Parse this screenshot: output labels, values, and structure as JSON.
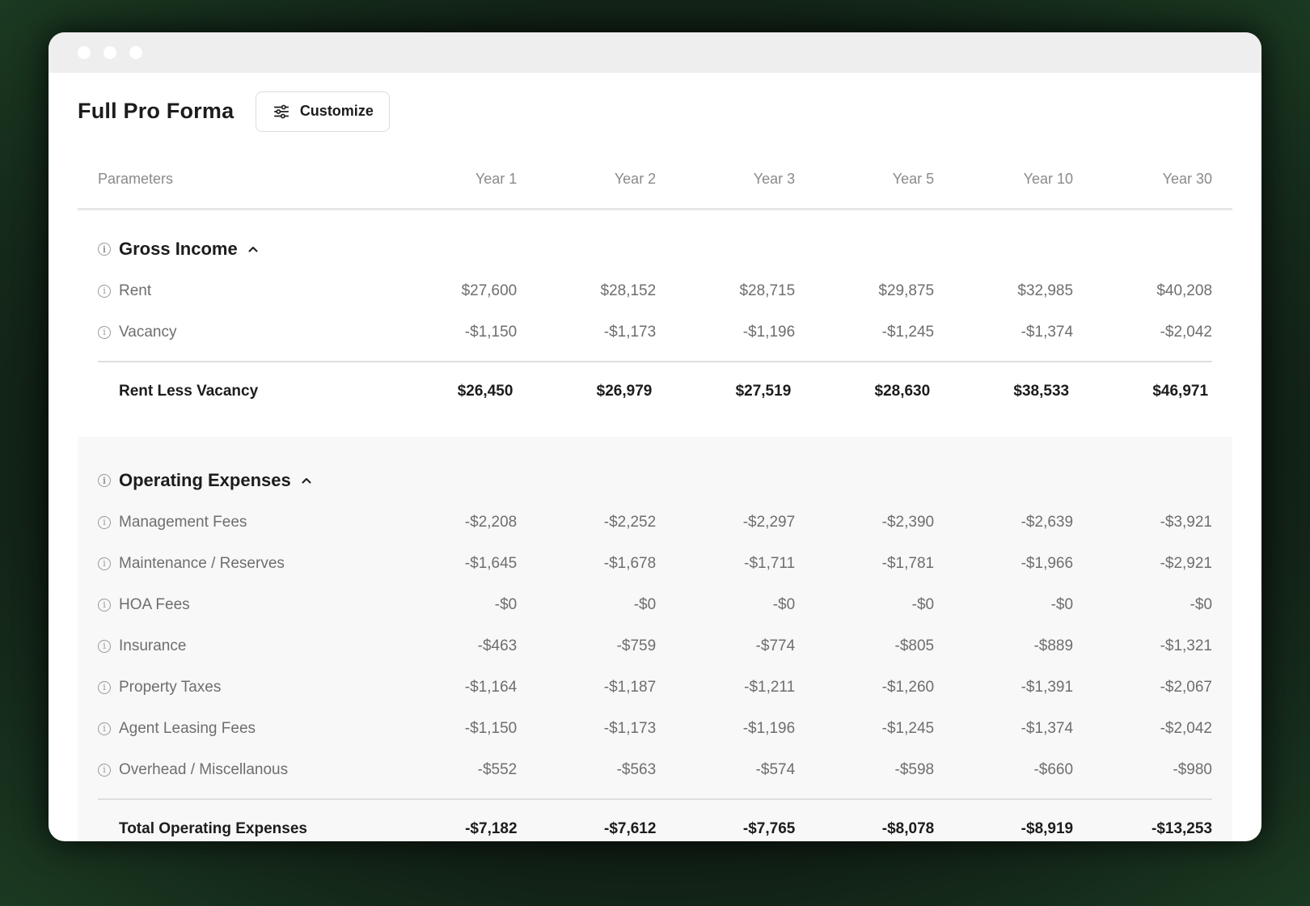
{
  "page": {
    "title": "Full Pro Forma",
    "customize_label": "Customize"
  },
  "columns": {
    "parameters": "Parameters",
    "years": [
      "Year 1",
      "Year 2",
      "Year 3",
      "Year 5",
      "Year 10",
      "Year 30"
    ]
  },
  "gross_income": {
    "title": "Gross Income",
    "rows": [
      {
        "label": "Rent",
        "values": [
          "$27,600",
          "$28,152",
          "$28,715",
          "$29,875",
          "$32,985",
          "$40,208"
        ]
      },
      {
        "label": "Vacancy",
        "values": [
          "-$1,150",
          "-$1,173",
          "-$1,196",
          "-$1,245",
          "-$1,374",
          "-$2,042"
        ]
      }
    ],
    "total": {
      "label": "Rent Less Vacancy",
      "values": [
        "$26,450",
        "$26,979",
        "$27,519",
        "$28,630",
        "$38,533",
        "$46,971"
      ]
    }
  },
  "operating_expenses": {
    "title": "Operating Expenses",
    "rows": [
      {
        "label": "Management Fees",
        "values": [
          "-$2,208",
          "-$2,252",
          "-$2,297",
          "-$2,390",
          "-$2,639",
          "-$3,921"
        ]
      },
      {
        "label": "Maintenance / Reserves",
        "values": [
          "-$1,645",
          "-$1,678",
          "-$1,711",
          "-$1,781",
          "-$1,966",
          "-$2,921"
        ]
      },
      {
        "label": "HOA Fees",
        "values": [
          "-$0",
          "-$0",
          "-$0",
          "-$0",
          "-$0",
          "-$0"
        ]
      },
      {
        "label": "Insurance",
        "values": [
          "-$463",
          "-$759",
          "-$774",
          "-$805",
          "-$889",
          "-$1,321"
        ]
      },
      {
        "label": "Property Taxes",
        "values": [
          "-$1,164",
          "-$1,187",
          "-$1,211",
          "-$1,260",
          "-$1,391",
          "-$2,067"
        ]
      },
      {
        "label": "Agent Leasing Fees",
        "values": [
          "-$1,150",
          "-$1,173",
          "-$1,196",
          "-$1,245",
          "-$1,374",
          "-$2,042"
        ]
      },
      {
        "label": "Overhead / Miscellanous",
        "values": [
          "-$552",
          "-$563",
          "-$574",
          "-$598",
          "-$660",
          "-$980"
        ]
      }
    ],
    "total": {
      "label": "Total Operating Expenses",
      "values": [
        "-$7,182",
        "-$7,612",
        "-$7,765",
        "-$8,078",
        "-$8,919",
        "-$13,253"
      ]
    }
  }
}
